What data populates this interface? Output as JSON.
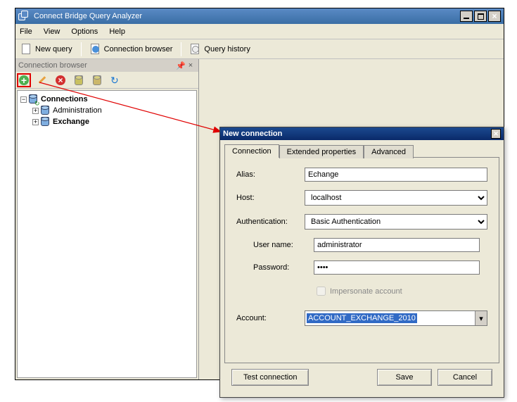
{
  "window": {
    "title": "Connect Bridge Query Analyzer"
  },
  "menu": {
    "file": "File",
    "view": "View",
    "options": "Options",
    "help": "Help"
  },
  "toolbar": {
    "new_query": "New query",
    "conn_browser": "Connection browser",
    "query_history": "Query history"
  },
  "panel": {
    "title": "Connection browser"
  },
  "tree": {
    "root": "Connections",
    "items": [
      "Administration",
      "Exchange"
    ]
  },
  "dialog": {
    "title": "New connection",
    "tabs": {
      "connection": "Connection",
      "extended": "Extended properties",
      "advanced": "Advanced"
    },
    "labels": {
      "alias": "Alias:",
      "host": "Host:",
      "auth": "Authentication:",
      "user": "User name:",
      "pass": "Password:",
      "impersonate": "Impersonate account",
      "account": "Account:"
    },
    "values": {
      "alias": "Echange",
      "host": "localhost",
      "auth": "Basic Authentication",
      "user": "administrator",
      "pass": "••••",
      "account": "ACCOUNT_EXCHANGE_2010"
    },
    "buttons": {
      "test": "Test connection",
      "save": "Save",
      "cancel": "Cancel"
    }
  }
}
